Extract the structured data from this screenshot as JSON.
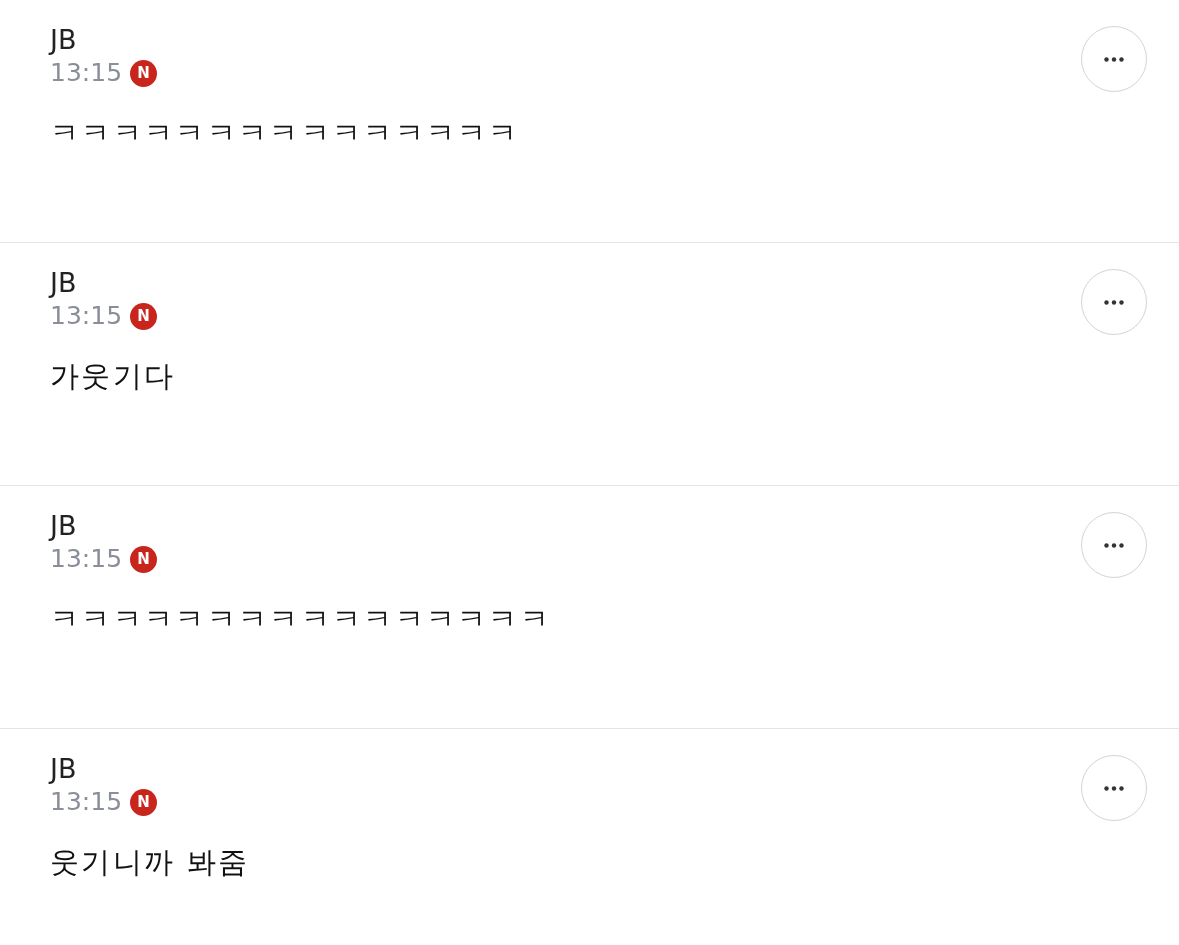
{
  "comments": [
    {
      "author": "JB",
      "time": "13:15",
      "badge": "N",
      "text": "ㅋㅋㅋㅋㅋㅋㅋㅋㅋㅋㅋㅋㅋㅋㅋ"
    },
    {
      "author": "JB",
      "time": "13:15",
      "badge": "N",
      "text": "가웃기다"
    },
    {
      "author": "JB",
      "time": "13:15",
      "badge": "N",
      "text": "ㅋㅋㅋㅋㅋㅋㅋㅋㅋㅋㅋㅋㅋㅋㅋㅋ"
    },
    {
      "author": "JB",
      "time": "13:15",
      "badge": "N",
      "text": "웃기니까 봐줌"
    }
  ]
}
